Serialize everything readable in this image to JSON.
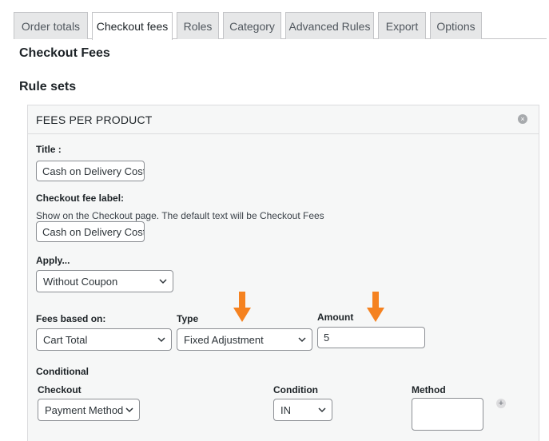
{
  "tabs": [
    {
      "label": "Order totals"
    },
    {
      "label": "Checkout fees"
    },
    {
      "label": "Roles"
    },
    {
      "label": "Category"
    },
    {
      "label": "Advanced Rules"
    },
    {
      "label": "Export"
    },
    {
      "label": "Options"
    }
  ],
  "active_tab": "Checkout fees",
  "headings": {
    "checkout_fees": "Checkout Fees",
    "rule_sets": "Rule sets"
  },
  "panel": {
    "title": "FEES PER PRODUCT",
    "close_icon": "close-circle-icon",
    "title_field": {
      "label": "Title :",
      "value": "Cash on Delivery Cost"
    },
    "fee_label_field": {
      "label": "Checkout fee label:",
      "description": "Show on the Checkout page. The default text will be Checkout Fees",
      "value": "Cash on Delivery Cost"
    },
    "apply": {
      "label": "Apply...",
      "selected": "Without Coupon"
    },
    "fees_based_on": {
      "label": "Fees based on:",
      "selected": "Cart Total"
    },
    "type": {
      "label": "Type",
      "selected": "Fixed Adjustment"
    },
    "amount": {
      "label": "Amount",
      "value": "5"
    },
    "conditional": {
      "label": "Conditional",
      "checkout": {
        "label": "Checkout",
        "selected": "Payment Method"
      },
      "condition": {
        "label": "Condition",
        "selected": "IN"
      },
      "method": {
        "label": "Method",
        "value": ""
      },
      "add_icon": "plus-circle-icon"
    }
  },
  "annotation_color": "#f58220"
}
